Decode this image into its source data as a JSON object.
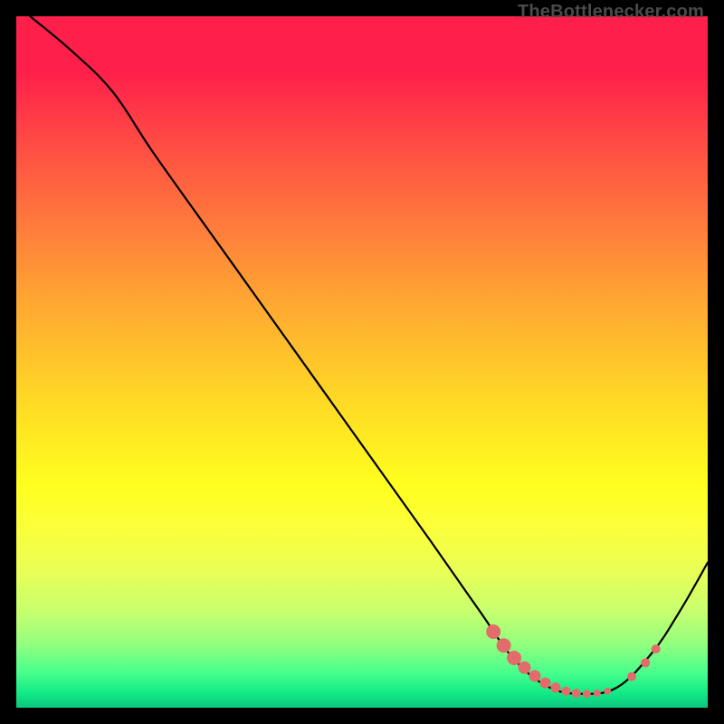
{
  "attribution": "TheBottlenecker.com",
  "chart_data": {
    "type": "line",
    "title": "",
    "xlabel": "",
    "ylabel": "",
    "xlim": [
      0,
      100
    ],
    "ylim": [
      0,
      100
    ],
    "curve": [
      {
        "x": 2,
        "y": 100
      },
      {
        "x": 8,
        "y": 95
      },
      {
        "x": 14,
        "y": 89
      },
      {
        "x": 20,
        "y": 80
      },
      {
        "x": 30,
        "y": 66
      },
      {
        "x": 40,
        "y": 52
      },
      {
        "x": 50,
        "y": 38
      },
      {
        "x": 60,
        "y": 24
      },
      {
        "x": 67,
        "y": 14
      },
      {
        "x": 72,
        "y": 7
      },
      {
        "x": 77,
        "y": 3
      },
      {
        "x": 82,
        "y": 2
      },
      {
        "x": 87,
        "y": 3
      },
      {
        "x": 92,
        "y": 8
      },
      {
        "x": 96,
        "y": 14
      },
      {
        "x": 100,
        "y": 21
      }
    ],
    "markers": [
      {
        "x": 69,
        "y": 11,
        "r": 8
      },
      {
        "x": 70.5,
        "y": 9,
        "r": 8
      },
      {
        "x": 72,
        "y": 7.2,
        "r": 8
      },
      {
        "x": 73.5,
        "y": 5.8,
        "r": 7
      },
      {
        "x": 75,
        "y": 4.6,
        "r": 6.5
      },
      {
        "x": 76.5,
        "y": 3.6,
        "r": 6
      },
      {
        "x": 78,
        "y": 2.9,
        "r": 5.5
      },
      {
        "x": 79.5,
        "y": 2.4,
        "r": 5
      },
      {
        "x": 81,
        "y": 2.1,
        "r": 5
      },
      {
        "x": 82.5,
        "y": 2.0,
        "r": 4.5
      },
      {
        "x": 84,
        "y": 2.1,
        "r": 4
      },
      {
        "x": 85.5,
        "y": 2.4,
        "r": 3.8
      },
      {
        "x": 89,
        "y": 4.5,
        "r": 5
      },
      {
        "x": 91,
        "y": 6.5,
        "r": 5
      },
      {
        "x": 92.5,
        "y": 8.5,
        "r": 5
      }
    ],
    "colors": {
      "curve": "#000000",
      "marker_fill": "#e36b6b",
      "marker_stroke": "#d95b5b"
    }
  }
}
